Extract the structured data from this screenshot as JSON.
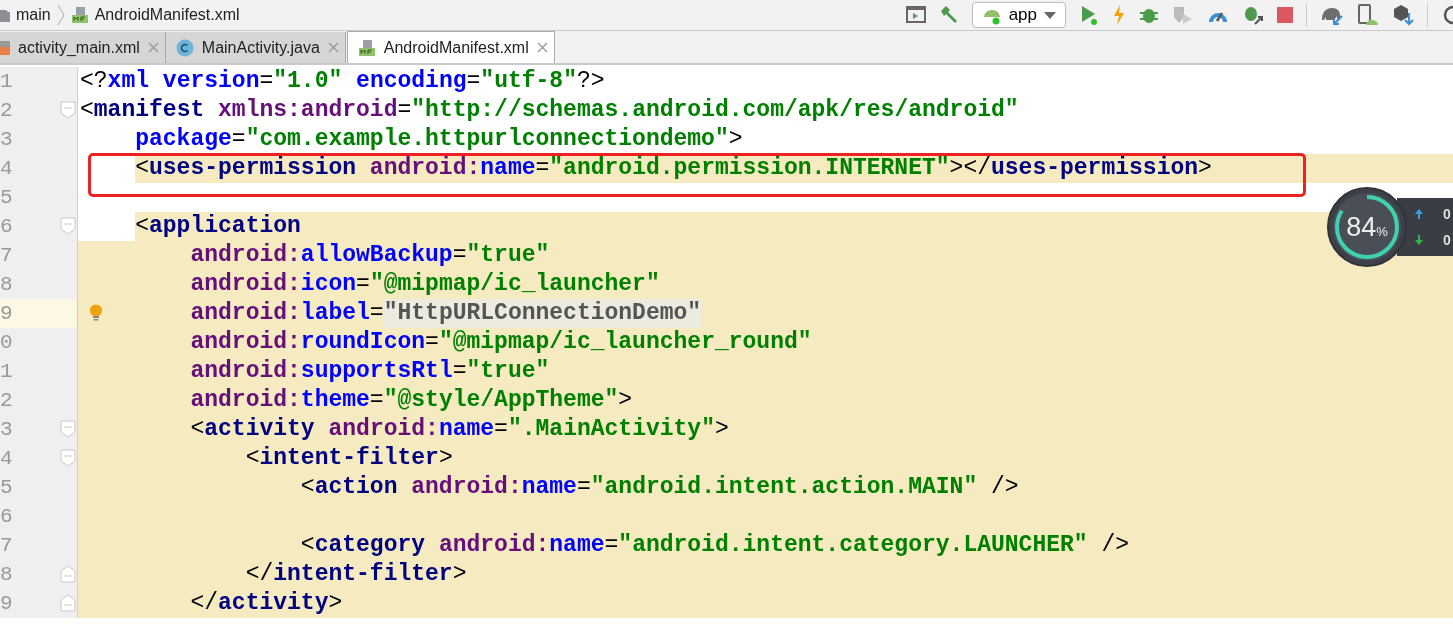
{
  "breadcrumb": {
    "items": [
      {
        "kind": "folder",
        "label": "main"
      },
      {
        "kind": "manifest",
        "label": "AndroidManifest.xml"
      }
    ]
  },
  "toolbar": {
    "config": "app"
  },
  "tabs": [
    {
      "label": "activity_main.xml",
      "kind": "layout",
      "selected": false
    },
    {
      "label": "MainActivity.java",
      "kind": "class",
      "selected": false
    },
    {
      "label": "AndroidManifest.xml",
      "kind": "manifest",
      "selected": true
    }
  ],
  "lines": [
    {
      "num": "1",
      "kind": "plain",
      "fold_start": false,
      "fold_end": false,
      "highlighted": false,
      "current": false,
      "tokens": [
        {
          "kind": "punct",
          "text": "<?"
        },
        {
          "kind": "attr",
          "text": "xml "
        },
        {
          "kind": "attr",
          "text": "version"
        },
        {
          "kind": "punct",
          "text": "="
        },
        {
          "kind": "value",
          "text": "\"1.0\" "
        },
        {
          "kind": "attr",
          "text": "encoding"
        },
        {
          "kind": "punct",
          "text": "="
        },
        {
          "kind": "value",
          "text": "\"utf-8\""
        },
        {
          "kind": "punct",
          "text": "?>"
        }
      ]
    },
    {
      "num": "2",
      "kind": "plain",
      "fold_start": true,
      "fold_end": false,
      "highlighted": false,
      "current": false,
      "tokens": [
        {
          "kind": "punct",
          "text": "<"
        },
        {
          "kind": "tag",
          "text": "manifest "
        },
        {
          "kind": "ns",
          "text": "xmlns:android"
        },
        {
          "kind": "punct",
          "text": "="
        },
        {
          "kind": "value",
          "text": "\"http://schemas.android.com/apk/res/android\""
        }
      ]
    },
    {
      "num": "3",
      "kind": "plain",
      "fold_start": false,
      "fold_end": false,
      "highlighted": false,
      "current": false,
      "tokens": [
        {
          "kind": "attr",
          "text": "    package"
        },
        {
          "kind": "punct",
          "text": "="
        },
        {
          "kind": "value",
          "text": "\"com.example.httpurlconnectiondemo\""
        },
        {
          "kind": "punct",
          "text": ">"
        }
      ]
    },
    {
      "num": "4",
      "kind": "scopehead",
      "fold_start": false,
      "fold_end": false,
      "highlighted": true,
      "current": false,
      "tokens": [
        {
          "kind": "punct",
          "text": "    <"
        },
        {
          "kind": "tag",
          "text": "uses-permission "
        },
        {
          "kind": "ns",
          "text": "android:"
        },
        {
          "kind": "attr",
          "text": "name"
        },
        {
          "kind": "punct",
          "text": "="
        },
        {
          "kind": "value",
          "text": "\"android.permission.INTERNET\""
        },
        {
          "kind": "punct",
          "text": "></"
        },
        {
          "kind": "tag",
          "text": "uses-permission"
        },
        {
          "kind": "punct",
          "text": ">"
        }
      ]
    },
    {
      "num": "5",
      "kind": "plain",
      "fold_start": false,
      "fold_end": false,
      "highlighted": false,
      "current": false
    },
    {
      "num": "6",
      "kind": "scopehead",
      "fold_start": true,
      "fold_end": false,
      "highlighted": false,
      "current": false,
      "tokens": [
        {
          "kind": "punct",
          "text": "    <"
        },
        {
          "kind": "tag",
          "text": "application"
        }
      ]
    },
    {
      "num": "7",
      "kind": "scope",
      "fold_start": false,
      "fold_end": false,
      "highlighted": false,
      "current": false,
      "tokens": [
        {
          "kind": "ns",
          "text": "        android:"
        },
        {
          "kind": "attr",
          "text": "allowBackup"
        },
        {
          "kind": "punct",
          "text": "="
        },
        {
          "kind": "value",
          "text": "\"true\""
        }
      ]
    },
    {
      "num": "8",
      "kind": "scope",
      "fold_start": false,
      "fold_end": false,
      "highlighted": false,
      "current": false,
      "tokens": [
        {
          "kind": "ns",
          "text": "        android:"
        },
        {
          "kind": "attr",
          "text": "icon"
        },
        {
          "kind": "punct",
          "text": "="
        },
        {
          "kind": "value",
          "text": "\"@mipmap/ic_launcher\""
        }
      ]
    },
    {
      "num": "9",
      "kind": "scope",
      "fold_start": false,
      "fold_end": false,
      "highlighted": false,
      "current": true,
      "tokens": [
        {
          "kind": "ns",
          "text": "        android:"
        },
        {
          "kind": "attr",
          "text": "label"
        },
        {
          "kind": "punct",
          "text": "="
        },
        {
          "kind": "muted",
          "text": "\"HttpURLConnectionDemo\""
        }
      ]
    },
    {
      "num": "0",
      "kind": "scope",
      "fold_start": false,
      "fold_end": false,
      "highlighted": false,
      "current": false,
      "tokens": [
        {
          "kind": "ns",
          "text": "        android:"
        },
        {
          "kind": "attr",
          "text": "roundIcon"
        },
        {
          "kind": "punct",
          "text": "="
        },
        {
          "kind": "value",
          "text": "\"@mipmap/ic_launcher_round\""
        }
      ]
    },
    {
      "num": "1",
      "kind": "scope",
      "fold_start": false,
      "fold_end": false,
      "highlighted": false,
      "current": false,
      "tokens": [
        {
          "kind": "ns",
          "text": "        android:"
        },
        {
          "kind": "attr",
          "text": "supportsRtl"
        },
        {
          "kind": "punct",
          "text": "="
        },
        {
          "kind": "value",
          "text": "\"true\""
        }
      ]
    },
    {
      "num": "2",
      "kind": "scope",
      "fold_start": false,
      "fold_end": false,
      "highlighted": false,
      "current": false,
      "tokens": [
        {
          "kind": "ns",
          "text": "        android:"
        },
        {
          "kind": "attr",
          "text": "theme"
        },
        {
          "kind": "punct",
          "text": "="
        },
        {
          "kind": "value",
          "text": "\"@style/AppTheme\""
        },
        {
          "kind": "punct",
          "text": ">"
        }
      ]
    },
    {
      "num": "3",
      "kind": "scope",
      "fold_start": true,
      "fold_end": false,
      "highlighted": false,
      "current": false,
      "tokens": [
        {
          "kind": "punct",
          "text": "        <"
        },
        {
          "kind": "tag",
          "text": "activity "
        },
        {
          "kind": "ns",
          "text": "android:"
        },
        {
          "kind": "attr",
          "text": "name"
        },
        {
          "kind": "punct",
          "text": "="
        },
        {
          "kind": "value",
          "text": "\".MainActivity\""
        },
        {
          "kind": "punct",
          "text": ">"
        }
      ]
    },
    {
      "num": "4",
      "kind": "scope",
      "fold_start": true,
      "fold_end": false,
      "highlighted": false,
      "current": false,
      "tokens": [
        {
          "kind": "punct",
          "text": "            <"
        },
        {
          "kind": "tag",
          "text": "intent-filter"
        },
        {
          "kind": "punct",
          "text": ">"
        }
      ]
    },
    {
      "num": "5",
      "kind": "scope",
      "fold_start": false,
      "fold_end": false,
      "highlighted": false,
      "current": false,
      "tokens": [
        {
          "kind": "punct",
          "text": "                <"
        },
        {
          "kind": "tag",
          "text": "action "
        },
        {
          "kind": "ns",
          "text": "android:"
        },
        {
          "kind": "attr",
          "text": "name"
        },
        {
          "kind": "punct",
          "text": "="
        },
        {
          "kind": "value",
          "text": "\"android.intent.action.MAIN\""
        },
        {
          "kind": "punct",
          "text": " />"
        }
      ]
    },
    {
      "num": "6",
      "kind": "scope",
      "fold_start": false,
      "fold_end": false,
      "highlighted": false,
      "current": false
    },
    {
      "num": "7",
      "kind": "scope",
      "fold_start": false,
      "fold_end": false,
      "highlighted": false,
      "current": false,
      "tokens": [
        {
          "kind": "punct",
          "text": "                <"
        },
        {
          "kind": "tag",
          "text": "category "
        },
        {
          "kind": "ns",
          "text": "android:"
        },
        {
          "kind": "attr",
          "text": "name"
        },
        {
          "kind": "punct",
          "text": "="
        },
        {
          "kind": "value",
          "text": "\"android.intent.category.LAUNCHER\""
        },
        {
          "kind": "punct",
          "text": " />"
        }
      ]
    },
    {
      "num": "8",
      "kind": "scope",
      "fold_start": false,
      "fold_end": true,
      "highlighted": false,
      "current": false,
      "tokens": [
        {
          "kind": "punct",
          "text": "            </"
        },
        {
          "kind": "tag",
          "text": "intent-filter"
        },
        {
          "kind": "punct",
          "text": ">"
        }
      ]
    },
    {
      "num": "9",
      "kind": "scope",
      "fold_start": false,
      "fold_end": true,
      "highlighted": false,
      "current": false,
      "tokens": [
        {
          "kind": "punct",
          "text": "        </"
        },
        {
          "kind": "tag",
          "text": "activity"
        },
        {
          "kind": "punct",
          "text": ">"
        }
      ]
    }
  ],
  "monitor": {
    "percent": "84",
    "unit": "%",
    "level": 0.84,
    "upload": "0",
    "download": "0"
  }
}
